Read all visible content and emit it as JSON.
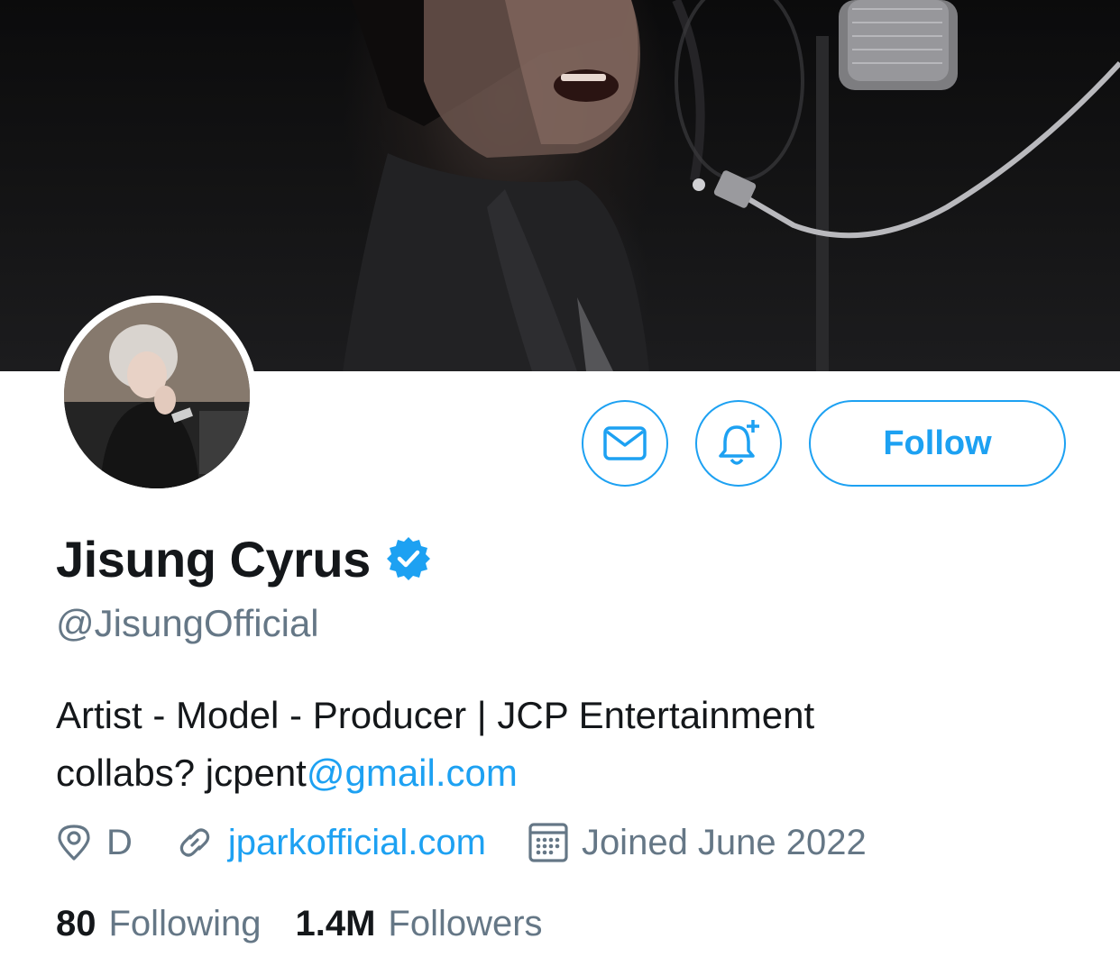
{
  "profile": {
    "display_name": "Jisung Cyrus",
    "handle": "@JisungOfficial",
    "bio_line1": "Artist - Model - Producer | JCP Entertainment",
    "bio_line2_prefix": "collabs? jcpent",
    "bio_line2_link": "@gmail.com",
    "location": "D",
    "website": "jparkofficial.com",
    "joined": "Joined June 2022"
  },
  "actions": {
    "follow_label": "Follow"
  },
  "stats": {
    "following_count": "80",
    "following_label": "Following",
    "followers_count": "1.4M",
    "followers_label": "Followers"
  },
  "icons": {
    "message": "envelope-icon",
    "notify": "bell-plus-icon",
    "verified": "verified-badge-icon",
    "location": "location-pin-icon",
    "link": "link-icon",
    "calendar": "calendar-icon"
  },
  "colors": {
    "accent": "#1da1f2",
    "text_primary": "#14171a",
    "text_secondary": "#657786"
  }
}
